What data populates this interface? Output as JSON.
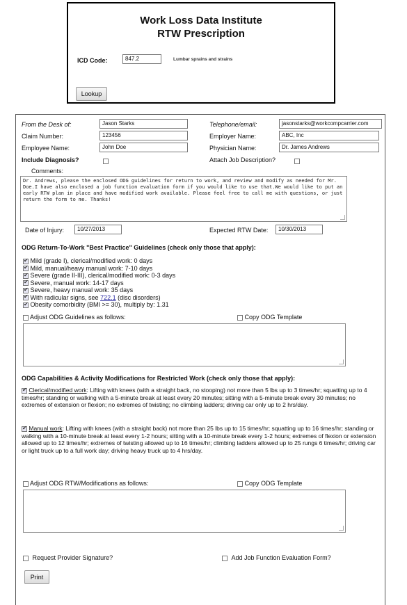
{
  "header": {
    "title": "Work Loss Data Institute",
    "subtitle": "RTW Prescription",
    "icd_label": "ICD Code:",
    "icd_value": "847.2",
    "icd_description": "Lumbar sprains and strains",
    "lookup_label": "Lookup"
  },
  "form": {
    "from_desk_label": "From the Desk of:",
    "from_desk_value": "Jason Starks",
    "telephone_label": "Telephone/email:",
    "telephone_value": "jasonstarks@workcompcarrier.com",
    "claim_label": "Claim Number:",
    "claim_value": "123456",
    "employer_label": "Employer Name:",
    "employer_value": "ABC, Inc",
    "employee_label": "Employee Name:",
    "employee_value": "John Doe",
    "physician_label": "Physician Name:",
    "physician_value": "Dr. James Andrews",
    "include_diag_label": "Include Diagnosis?",
    "attach_job_label": "Attach Job Description?",
    "comments_label": "Comments:",
    "comments_value": "Dr. Andrews, please the enclosed ODG guidelines for return to work, and review and modify as needed for Mr. Doe.I have also enclosed a job function evaluation form if you would like to use that.We would like to put an early RTW plan in place and have modified work available. Please feel free to call me with questions, or just return the form to me. Thanks!",
    "doi_label": "Date of Injury:",
    "doi_value": "10/27/2013",
    "rtw_label": "Expected RTW Date:",
    "rtw_value": "10/30/2013"
  },
  "guidelines": {
    "heading": "ODG Return-To-Work \"Best Practice\" Guidelines (check only those that apply):",
    "items": [
      "Mild (grade I), clerical/modified work: 0 days",
      "Mild, manual/heavy manual work: 7-10 days",
      "Severe (grade II-III), clerical/modified work: 0-3 days",
      "Severe, manual work: 14-17 days",
      "Severe, heavy manual work: 35 days"
    ],
    "radicular_prefix": "With radicular signs, see",
    "radicular_link": "722.1",
    "radicular_suffix": "(disc disorders)",
    "obesity": "Obesity comorbidity (BMI >= 30), multiply by: 1.31",
    "adjust_label": "Adjust ODG Guidelines as follows:",
    "copy_label": "Copy ODG Template"
  },
  "capabilities": {
    "heading": "ODG Capabilities & Activity Modifications for Restricted Work (check only those that apply):",
    "clerical_title": "Clerical/modified work",
    "clerical_text": ": Lifting with knees (with a straight back, no stooping) not more than 5 lbs up to 3 times/hr; squatting up to 4 times/hr; standing or walking with a 5-minute break at least every 20 minutes; sitting with a 5-minute break every 30 minutes; no extremes of extension or flexion; no extremes of twisting; no climbing ladders; driving car only up to 2 hrs/day.",
    "manual_title": "Manual work",
    "manual_text": ": Lifting with knees (with a straight back) not more than 25 lbs up to 15 times/hr; squatting up to 16 times/hr; standing or walking with a 10-minute break at least every 1-2 hours; sitting with a 10-minute break every 1-2 hours; extremes of flexion or extension allowed up to 12 times/hr; extremes of twisting allowed up to 16 times/hr; climbing ladders allowed up to 25 rungs 6 times/hr; driving car or light truck up to a full work day; driving heavy truck up to 4 hrs/day.",
    "adjust_label": "Adjust ODG RTW/Modifications as follows:",
    "copy_label": "Copy ODG Template"
  },
  "footer": {
    "request_sig_label": "Request Provider Signature?",
    "add_job_label": "Add Job Function Evaluation Form?",
    "print_label": "Print"
  }
}
